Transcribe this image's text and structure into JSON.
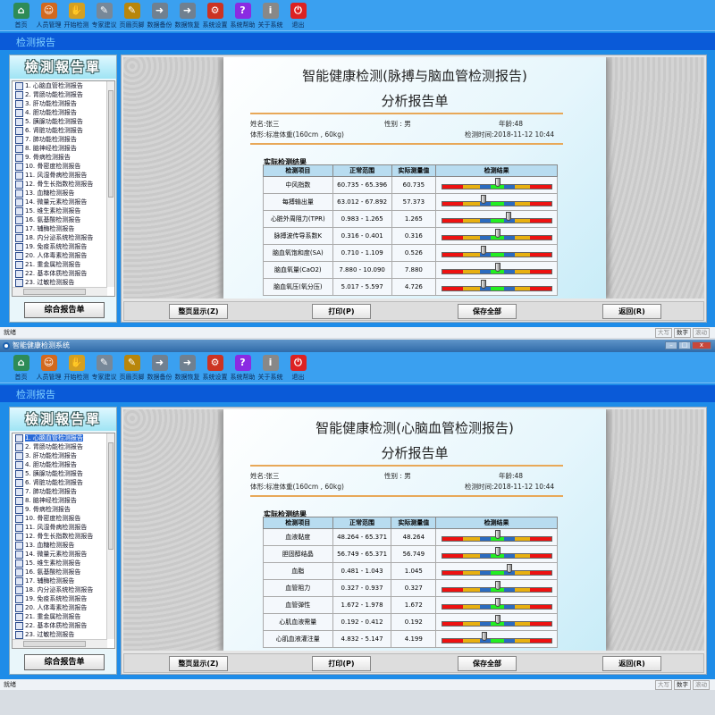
{
  "colors": {
    "toolbar": "#3aa0f0",
    "header": "#0a5ad8",
    "bar_red": "#ee1111",
    "bar_yellow": "#e8b010",
    "bar_blue": "#2a6bc0",
    "bar_green": "#22ee22"
  },
  "toolbar": [
    {
      "label": "首页",
      "icon": "home-icon",
      "color": "#2e8b57",
      "glyph": "⌂"
    },
    {
      "label": "人员管理",
      "icon": "users-icon",
      "color": "#d2691e",
      "glyph": "☺"
    },
    {
      "label": "开始检测",
      "icon": "hand-icon",
      "color": "#d4a020",
      "glyph": "✋"
    },
    {
      "label": "专家建议",
      "icon": "clipboard-icon",
      "color": "#778899",
      "glyph": "✎"
    },
    {
      "label": "页眉页脚",
      "icon": "page-edit-icon",
      "color": "#b8860b",
      "glyph": "✎"
    },
    {
      "label": "数据备份",
      "icon": "backup-icon",
      "color": "#708090",
      "glyph": "➜"
    },
    {
      "label": "数据恢复",
      "icon": "restore-icon",
      "color": "#708090",
      "glyph": "➜"
    },
    {
      "label": "系统设置",
      "icon": "gears-icon",
      "color": "#cc3322",
      "glyph": "⚙"
    },
    {
      "label": "系统帮助",
      "icon": "help-icon",
      "color": "#8a2be2",
      "glyph": "?"
    },
    {
      "label": "关于系统",
      "icon": "about-icon",
      "color": "#888888",
      "glyph": "i"
    },
    {
      "label": "退出",
      "icon": "exit-icon",
      "color": "#dd2222",
      "glyph": "⏻"
    }
  ],
  "header": "检测报告",
  "banner": "檢測報告單",
  "list": [
    "1. 心脑血管检测报告",
    "2. 胃肠功能检测报告",
    "3. 肝功能检测报告",
    "4. 胆功能检测报告",
    "5. 胰腺功能检测报告",
    "6. 肾脏功能检测报告",
    "7. 肺功能检测报告",
    "8. 脑神经检测报告",
    "9. 骨病检测报告",
    "10. 骨密度检测报告",
    "11. 风湿骨病检测报告",
    "12. 骨生长指数检测报告",
    "13. 血糖检测报告",
    "14. 微量元素检测报告",
    "15. 维生素检测报告",
    "16. 氨基酸检测报告",
    "17. 辅酶检测报告",
    "18. 内分泌系统检测报告",
    "19. 免疫系统检测报告",
    "20. 人体毒素检测报告",
    "21. 重金属检测报告",
    "22. 基本体质检测报告",
    "23. 过敏检测报告"
  ],
  "summary_button": "综合报告单",
  "buttons": [
    "整页显示(Z)",
    "打印(P)",
    "保存全部",
    "返回(R)"
  ],
  "status": {
    "text": "就绪",
    "caps": "大写",
    "num": "数字",
    "scroll": "滚动"
  },
  "patient": {
    "name": "姓名:张三",
    "gender": "性别 : 男",
    "age": "年龄:48",
    "body": "体形:标准体重(160cm , 60kg)",
    "time": "检测时间:2018-11-12 10:44"
  },
  "section": "实际检测结果",
  "columns": [
    "检测项目",
    "正常范围",
    "实际测量值",
    "检测结果"
  ],
  "subtitle": "分析报告单",
  "windows": [
    {
      "title_bar": "",
      "selected": -1,
      "title": "智能健康检测(脉搏与脑血管检测报告)",
      "rows": [
        {
          "item": "中风指数",
          "range": "60.735 - 65.396",
          "value": "60.735",
          "level": 51
        },
        {
          "item": "每搏输出量",
          "range": "63.012 - 67.892",
          "value": "57.373",
          "level": 38
        },
        {
          "item": "心脏外周阻力(TPR)",
          "range": "0.983 - 1.265",
          "value": "1.265",
          "level": 61
        },
        {
          "item": "脉搏波传导系数K",
          "range": "0.316 - 0.401",
          "value": "0.316",
          "level": 51
        },
        {
          "item": "脑血氧饱和度(SA)",
          "range": "0.710 - 1.109",
          "value": "0.526",
          "level": 38
        },
        {
          "item": "脑血氧量(CaO2)",
          "range": "7.880 - 10.090",
          "value": "7.880",
          "level": 51
        },
        {
          "item": "脑血氧压(氧分压)",
          "range": "5.017 - 5.597",
          "value": "4.726",
          "level": 38
        }
      ]
    },
    {
      "title_bar": "智能健康检测系统",
      "selected": 0,
      "title": "智能健康检测(心脑血管检测报告)",
      "rows": [
        {
          "item": "血液黏度",
          "range": "48.264 - 65.371",
          "value": "48.264",
          "level": 51
        },
        {
          "item": "胆固醇结晶",
          "range": "56.749 - 65.371",
          "value": "56.749",
          "level": 51
        },
        {
          "item": "血脂",
          "range": "0.481 - 1.043",
          "value": "1.045",
          "level": 62
        },
        {
          "item": "血管阻力",
          "range": "0.327 - 0.937",
          "value": "0.327",
          "level": 51
        },
        {
          "item": "血管弹性",
          "range": "1.672 - 1.978",
          "value": "1.672",
          "level": 51
        },
        {
          "item": "心肌血液需量",
          "range": "0.192 - 0.412",
          "value": "0.192",
          "level": 51
        },
        {
          "item": "心肌血液灌注量",
          "range": "4.832 - 5.147",
          "value": "4.199",
          "level": 39
        }
      ]
    }
  ]
}
